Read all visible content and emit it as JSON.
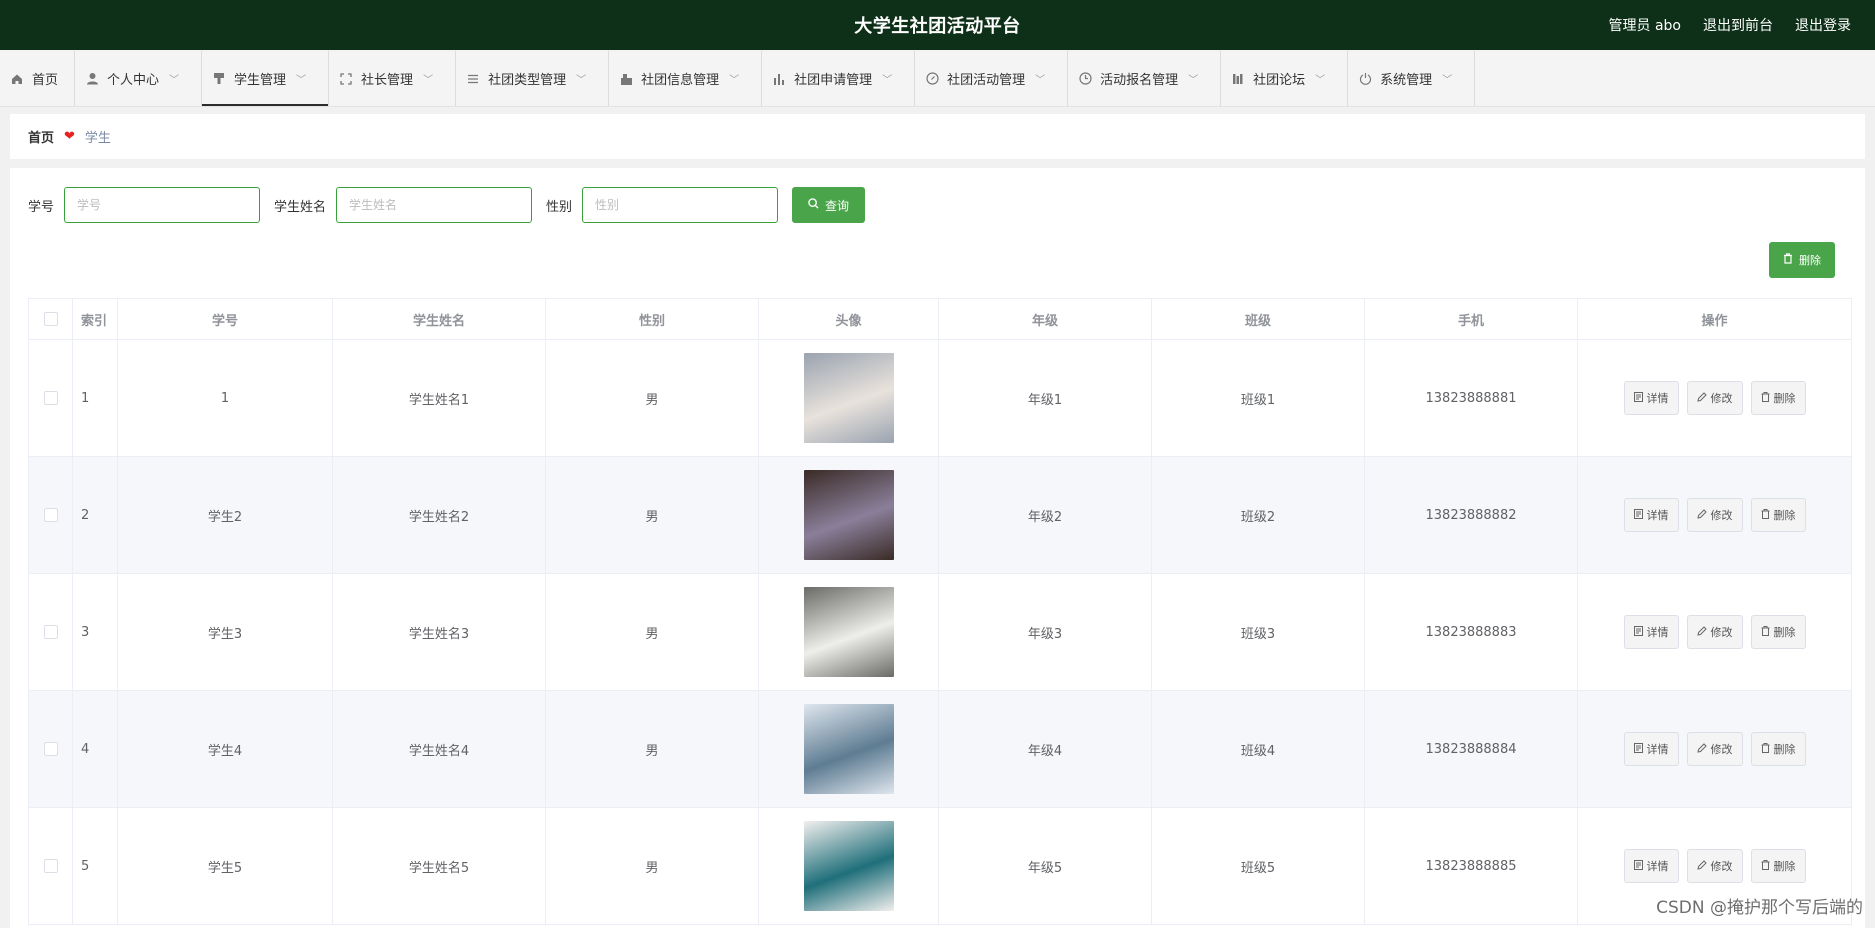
{
  "header": {
    "title": "大学生社团活动平台",
    "user": "管理员 abo",
    "front_link": "退出到前台",
    "logout": "退出登录"
  },
  "nav": [
    {
      "label": "首页",
      "icon": "home-icon",
      "caret": false
    },
    {
      "label": "个人中心",
      "icon": "user-icon",
      "caret": true
    },
    {
      "label": "学生管理",
      "icon": "stamp-icon",
      "caret": true,
      "active": true
    },
    {
      "label": "社长管理",
      "icon": "fullscreen-icon",
      "caret": true
    },
    {
      "label": "社团类型管理",
      "icon": "list-icon",
      "caret": true
    },
    {
      "label": "社团信息管理",
      "icon": "building-icon",
      "caret": true
    },
    {
      "label": "社团申请管理",
      "icon": "bar-chart-icon",
      "caret": true
    },
    {
      "label": "社团活动管理",
      "icon": "compass-icon",
      "caret": true
    },
    {
      "label": "活动报名管理",
      "icon": "clock-icon",
      "caret": true
    },
    {
      "label": "社团论坛",
      "icon": "books-icon",
      "caret": true
    },
    {
      "label": "系统管理",
      "icon": "power-icon",
      "caret": true
    }
  ],
  "breadcrumb": {
    "home": "首页",
    "current": "学生"
  },
  "search": {
    "id_label": "学号",
    "id_placeholder": "学号",
    "name_label": "学生姓名",
    "name_placeholder": "学生姓名",
    "gender_label": "性别",
    "gender_placeholder": "性别",
    "query_button": "查询"
  },
  "delete_button": "删除",
  "table": {
    "headers": [
      "索引",
      "学号",
      "学生姓名",
      "性别",
      "头像",
      "年级",
      "班级",
      "手机",
      "操作"
    ],
    "actions": {
      "detail": "详情",
      "edit": "修改",
      "delete": "删除"
    },
    "rows": [
      {
        "index": "1",
        "student_id": "1",
        "name": "学生姓名1",
        "gender": "男",
        "grade": "年级1",
        "class": "班级1",
        "phone": "13823888881",
        "avatar_colors": [
          "#9aa3b0",
          "#e8e2dc"
        ]
      },
      {
        "index": "2",
        "student_id": "学生2",
        "name": "学生姓名2",
        "gender": "男",
        "grade": "年级2",
        "class": "班级2",
        "phone": "13823888882",
        "avatar_colors": [
          "#3a2b26",
          "#8a7f9a"
        ]
      },
      {
        "index": "3",
        "student_id": "学生3",
        "name": "学生姓名3",
        "gender": "男",
        "grade": "年级3",
        "class": "班级3",
        "phone": "13823888883",
        "avatar_colors": [
          "#6a6a66",
          "#eeeeea"
        ]
      },
      {
        "index": "4",
        "student_id": "学生4",
        "name": "学生姓名4",
        "gender": "男",
        "grade": "年级4",
        "class": "班级4",
        "phone": "13823888884",
        "avatar_colors": [
          "#dfe6ee",
          "#5e7c92"
        ]
      },
      {
        "index": "5",
        "student_id": "学生5",
        "name": "学生姓名5",
        "gender": "男",
        "grade": "年级5",
        "class": "班级5",
        "phone": "13823888885",
        "avatar_colors": [
          "#f2efee",
          "#1f6f7a"
        ]
      }
    ]
  },
  "watermark": "CSDN @掩护那个写后端的"
}
